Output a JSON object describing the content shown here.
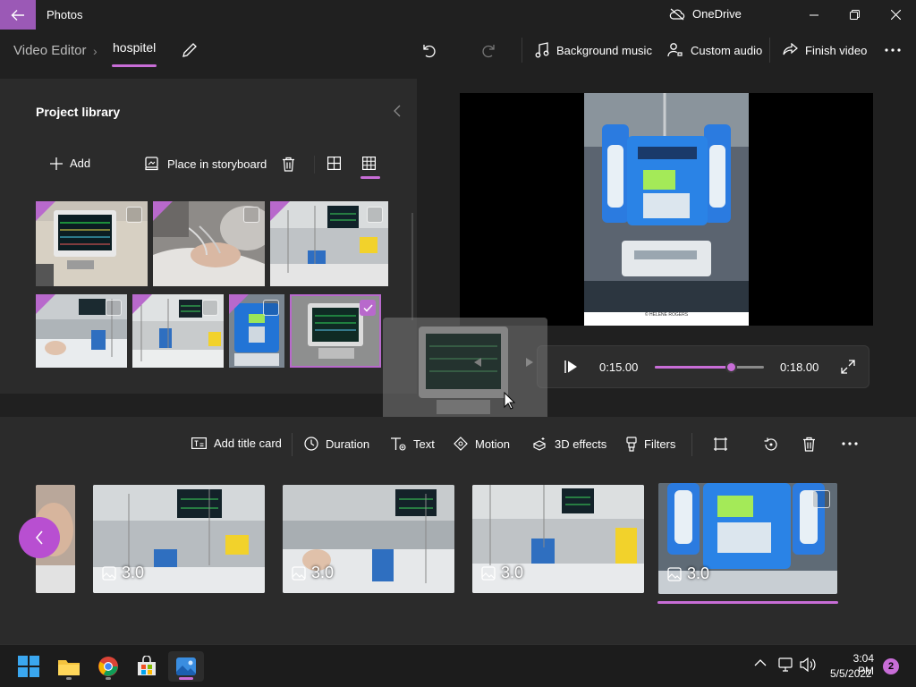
{
  "window": {
    "app_name": "Photos",
    "onedrive_label": "OneDrive"
  },
  "breadcrumb": {
    "root": "Video Editor",
    "project": "hospitel"
  },
  "toolbar": {
    "background_music": "Background music",
    "custom_audio": "Custom audio",
    "finish_video": "Finish video"
  },
  "library": {
    "title": "Project library",
    "add_label": "Add",
    "place_label": "Place in storyboard",
    "thumbnails": [
      {
        "subject": "patient monitor",
        "in_use": true,
        "selected": false
      },
      {
        "subject": "hand with IV line",
        "in_use": true,
        "selected": false
      },
      {
        "subject": "ICU room",
        "in_use": true,
        "selected": false
      },
      {
        "subject": "patient in bed",
        "in_use": true,
        "selected": false
      },
      {
        "subject": "ICU room with monitor",
        "in_use": true,
        "selected": false
      },
      {
        "subject": "infusion pump",
        "in_use": true,
        "selected": false
      },
      {
        "subject": "patient monitor close-up",
        "in_use": false,
        "selected": true
      }
    ]
  },
  "preview": {
    "caption": "© HELENE ROGERS",
    "current_time": "0:15.00",
    "total_time": "0:18.00",
    "progress": 0.83
  },
  "storyboard": {
    "tools": {
      "add_title_card": "Add title card",
      "duration": "Duration",
      "text": "Text",
      "motion": "Motion",
      "effects_3d": "3D effects",
      "filters": "Filters"
    },
    "clips": [
      {
        "duration": "3.0",
        "subject": "ICU room with yellow bin"
      },
      {
        "duration": "3.0",
        "subject": "patient in ICU bed"
      },
      {
        "duration": "3.0",
        "subject": "ICU room with yellow bin"
      },
      {
        "duration": "3.0",
        "subject": "infusion pump",
        "selected": true
      }
    ]
  },
  "taskbar": {
    "time": "3:04 PM",
    "date": "5/5/2022",
    "notifications": "2"
  },
  "colors": {
    "accent": "#c86dd7",
    "back_button": "#9b59b6",
    "panel": "#2b2b2b",
    "background": "#202020"
  }
}
